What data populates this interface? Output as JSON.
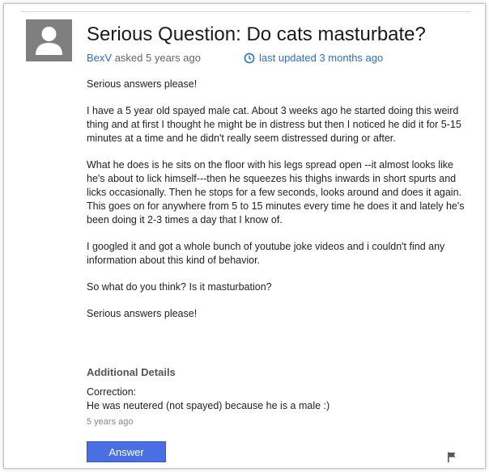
{
  "question": {
    "title": "Serious Question: Do cats masturbate?",
    "author": "BexV",
    "asked": "asked 5 years ago",
    "updated": "last updated 3 months ago",
    "paragraphs": [
      "Serious answers please!",
      "I have a 5 year old spayed male cat. About 3 weeks ago he started doing this weird thing and at first I thought he might be in distress but then I noticed he did it for 5-15 minutes at a time and he didn't really seem distressed during or after.",
      "What he does is he sits on the floor with his legs spread open --it almost looks like he's about to lick himself---then he squeezes his thighs inwards in short spurts and licks occasionally. Then he stops for a few seconds, looks around and does it again. This goes on for anywhere from 5 to 15 minutes every time he does it and lately he's been doing it 2-3 times a day that I know of.",
      "I googled it and got a whole bunch of youtube joke videos and i couldn't find any information about this kind of behavior.",
      "So what do you think? Is it masturbation?",
      "Serious answers please!"
    ]
  },
  "additional_details": {
    "heading": "Additional Details",
    "line1": "Correction:",
    "line2": "He was neutered (not spayed) because he is a male :)",
    "age": "5 years ago"
  },
  "actions": {
    "answer_label": "Answer"
  },
  "icons": {
    "avatar": "default-user-avatar-icon",
    "clock": "clock-icon",
    "flag": "flag-icon"
  },
  "colors": {
    "link": "#2d6fbf",
    "button": "#4a6fe3",
    "avatar_bg": "#7f7f7f"
  }
}
